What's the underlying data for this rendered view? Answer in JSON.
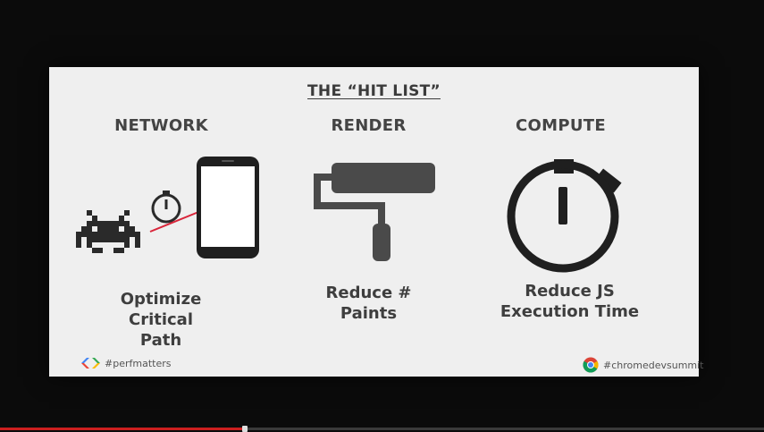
{
  "slide": {
    "title": "THE “HIT LIST”",
    "columns": [
      {
        "heading": "NETWORK",
        "lines": [
          "Optimize",
          "Critical",
          "Path"
        ],
        "icons": [
          "space-invader-icon",
          "stopwatch-icon",
          "smartphone-icon"
        ]
      },
      {
        "heading": "RENDER",
        "lines": [
          "Reduce #",
          "Paints"
        ],
        "icons": [
          "paint-roller-icon"
        ]
      },
      {
        "heading": "COMPUTE",
        "lines": [
          "Reduce JS",
          "Execution Time"
        ],
        "icons": [
          "stopwatch-icon"
        ]
      }
    ],
    "footer_left": {
      "text": "#perfmatters",
      "icon": "google-developers-logo"
    },
    "footer_right": {
      "text": "#chromedevsummit",
      "icon": "chrome-logo"
    }
  },
  "video": {
    "progress_fraction": 0.32
  },
  "colors": {
    "slide_bg": "#efefef",
    "text": "#3e3e3e",
    "accent_arrow": "#d9253a",
    "progress": "#cc1f1f"
  }
}
